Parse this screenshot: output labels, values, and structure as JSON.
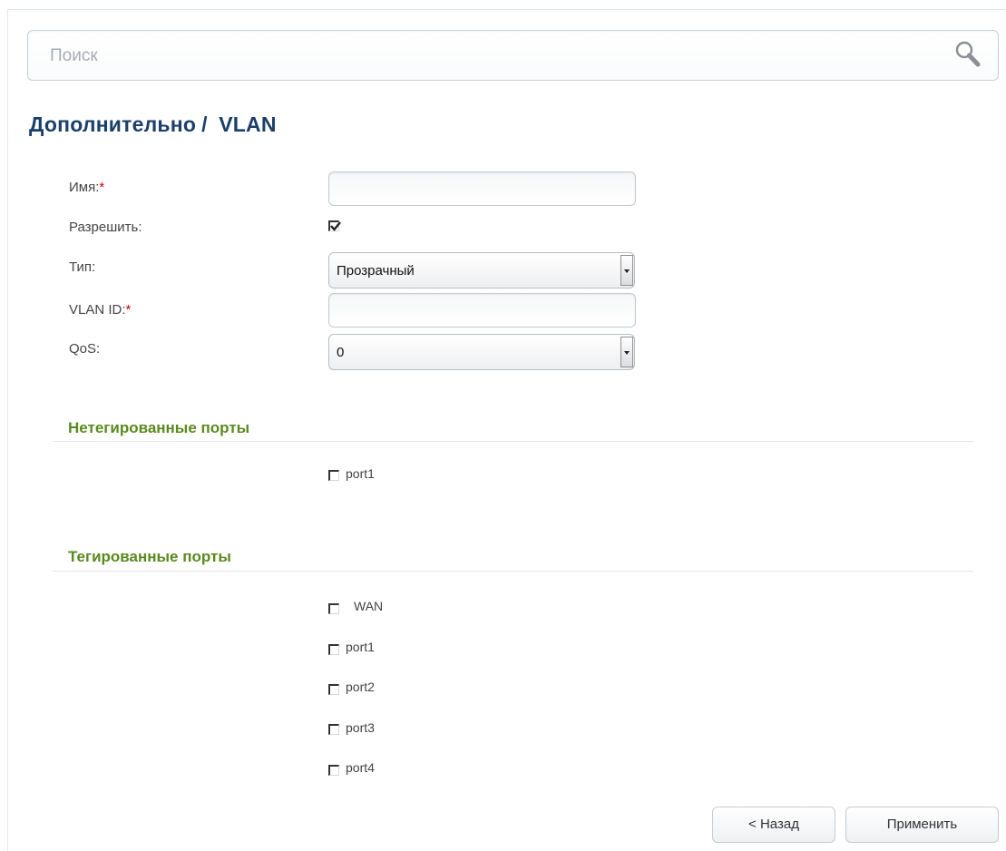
{
  "search": {
    "placeholder": "Поиск",
    "icon": "search-icon"
  },
  "page": {
    "breadcrumb_parent": "Дополнительно",
    "breadcrumb_separator": "/",
    "breadcrumb_current": "VLAN"
  },
  "form": {
    "name_label": "Имя:",
    "name_value": "",
    "enable_label": "Разрешить:",
    "enable_checked": true,
    "type_label": "Тип:",
    "type_value": "Прозрачный",
    "vlan_id_label": "VLAN ID:",
    "vlan_id_value": "",
    "qos_label": "QoS:",
    "qos_value": "0",
    "required_marker": "*"
  },
  "untagged": {
    "title": "Нетегированные порты",
    "ports": [
      {
        "label": "port1",
        "checked": false
      }
    ]
  },
  "tagged": {
    "title": "Тегированные порты",
    "ports": [
      {
        "label": "WAN",
        "checked": false
      },
      {
        "label": "port1",
        "checked": false
      },
      {
        "label": "port2",
        "checked": false
      },
      {
        "label": "port3",
        "checked": false
      },
      {
        "label": "port4",
        "checked": false
      }
    ]
  },
  "buttons": {
    "back_label": "< Назад",
    "apply_label": "Применить"
  },
  "colors": {
    "title": "#1b3f6b",
    "section": "#5a8a1e",
    "required": "#d40000"
  }
}
